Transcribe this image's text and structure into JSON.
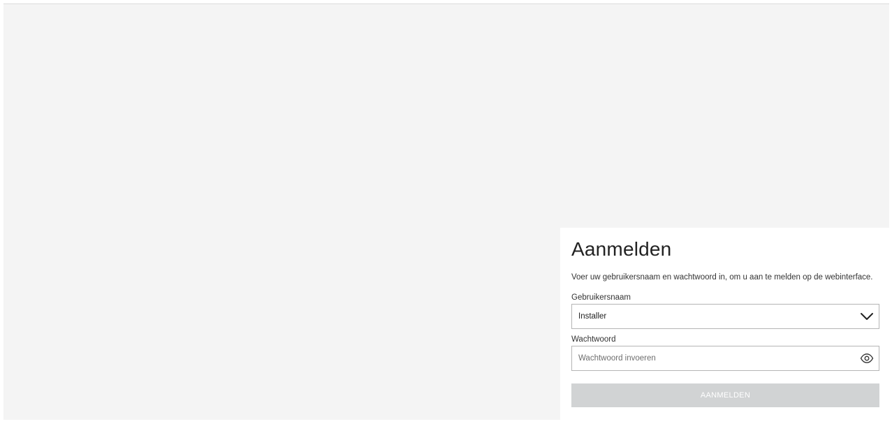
{
  "login": {
    "title": "Aanmelden",
    "description": "Voer uw gebruikersnaam en wachtwoord in, om u aan te melden op de webinterface.",
    "username": {
      "label": "Gebruikersnaam",
      "selected": "Installer",
      "icon": "chevron-down-icon"
    },
    "password": {
      "label": "Wachtwoord",
      "value": "",
      "placeholder": "Wachtwoord invoeren",
      "icon": "eye-icon"
    },
    "submit_label": "AANMELDEN",
    "colors": {
      "page_background": "#f4f4f4",
      "panel_background": "#ffffff",
      "button_disabled": "#d1d3d4",
      "border": "#b5b5b5"
    }
  }
}
